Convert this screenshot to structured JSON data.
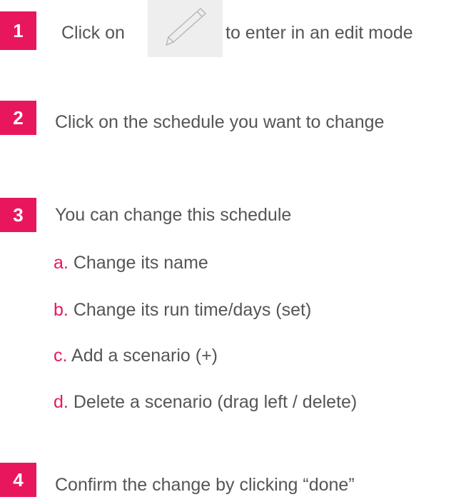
{
  "colors": {
    "accent": "#e8175d",
    "text": "#555555",
    "icon_box": "#eeeeee"
  },
  "steps": [
    {
      "number": "1",
      "text_before": "Click on",
      "icon": "pencil-icon",
      "text_after": "to enter in an edit mode"
    },
    {
      "number": "2",
      "text": "Click on the schedule you want to change"
    },
    {
      "number": "3",
      "text": "You can change this schedule",
      "sub_items": [
        {
          "letter": "a.",
          "text": "Change its name"
        },
        {
          "letter": "b.",
          "text": "Change its run time/days (set)"
        },
        {
          "letter": "c.",
          "text": "Add a scenario (+)"
        },
        {
          "letter": "d.",
          "text": "Delete a scenario (drag left / delete)"
        }
      ]
    },
    {
      "number": "4",
      "text": "Confirm the change by clicking “done”"
    }
  ]
}
